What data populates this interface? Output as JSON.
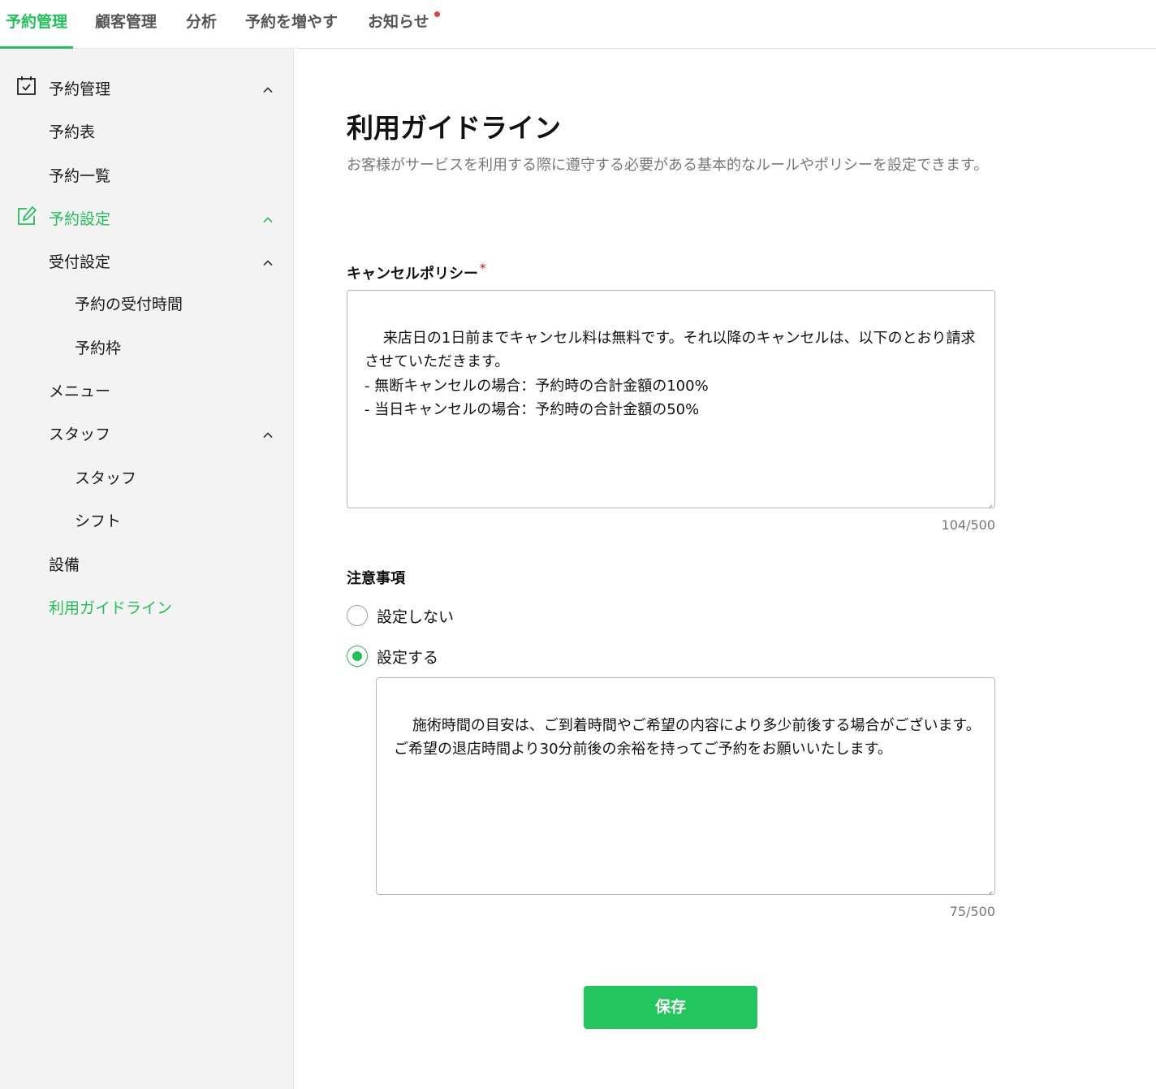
{
  "topnav": {
    "tabs": [
      {
        "label": "予約管理",
        "active": true
      },
      {
        "label": "顧客管理",
        "active": false
      },
      {
        "label": "分析",
        "active": false
      },
      {
        "label": "予約を増やす",
        "active": false
      },
      {
        "label": "お知らせ",
        "active": false,
        "has_notification_dot": true
      }
    ]
  },
  "sidebar": {
    "items": [
      {
        "label": "予約管理",
        "icon": "calendar-check-icon",
        "expanded": true
      },
      {
        "label": "予約表"
      },
      {
        "label": "予約一覧"
      },
      {
        "label": "予約設定",
        "icon": "edit-icon",
        "expanded": true,
        "highlighted": true
      },
      {
        "label": "受付設定",
        "expanded": true
      },
      {
        "label": "予約の受付時間"
      },
      {
        "label": "予約枠"
      },
      {
        "label": "メニュー"
      },
      {
        "label": "スタッフ",
        "expanded": true
      },
      {
        "label": "スタッフ"
      },
      {
        "label": "シフト"
      },
      {
        "label": "設備"
      },
      {
        "label": "利用ガイドライン",
        "active": true
      }
    ]
  },
  "main": {
    "title": "利用ガイドライン",
    "description": "お客様がサービスを利用する際に遵守する必要がある基本的なルールやポリシーを設定できます。",
    "cancel_policy": {
      "label": "キャンセルポリシー",
      "required_mark": "*",
      "value": "来店日の1日前までキャンセル料は無料です。それ以降のキャンセルは、以下のとおり請求させていただきます。\n- 無断キャンセルの場合：予約時の合計金額の100%\n- 当日キャンセルの場合：予約時の合計金額の50%",
      "counter": "104/500"
    },
    "notes": {
      "label": "注意事項",
      "options": [
        {
          "label": "設定しない",
          "checked": false
        },
        {
          "label": "設定する",
          "checked": true
        }
      ],
      "value": "施術時間の目安は、ご到着時間やご希望の内容により多少前後する場合がございます。\nご希望の退店時間より30分前後の余裕を持ってご予約をお願いいたします。",
      "counter": "75/500"
    },
    "save_label": "保存"
  },
  "colors": {
    "accent": "#22c05a",
    "required": "#e0433b",
    "sidebar_bg": "#f3f3f3"
  }
}
